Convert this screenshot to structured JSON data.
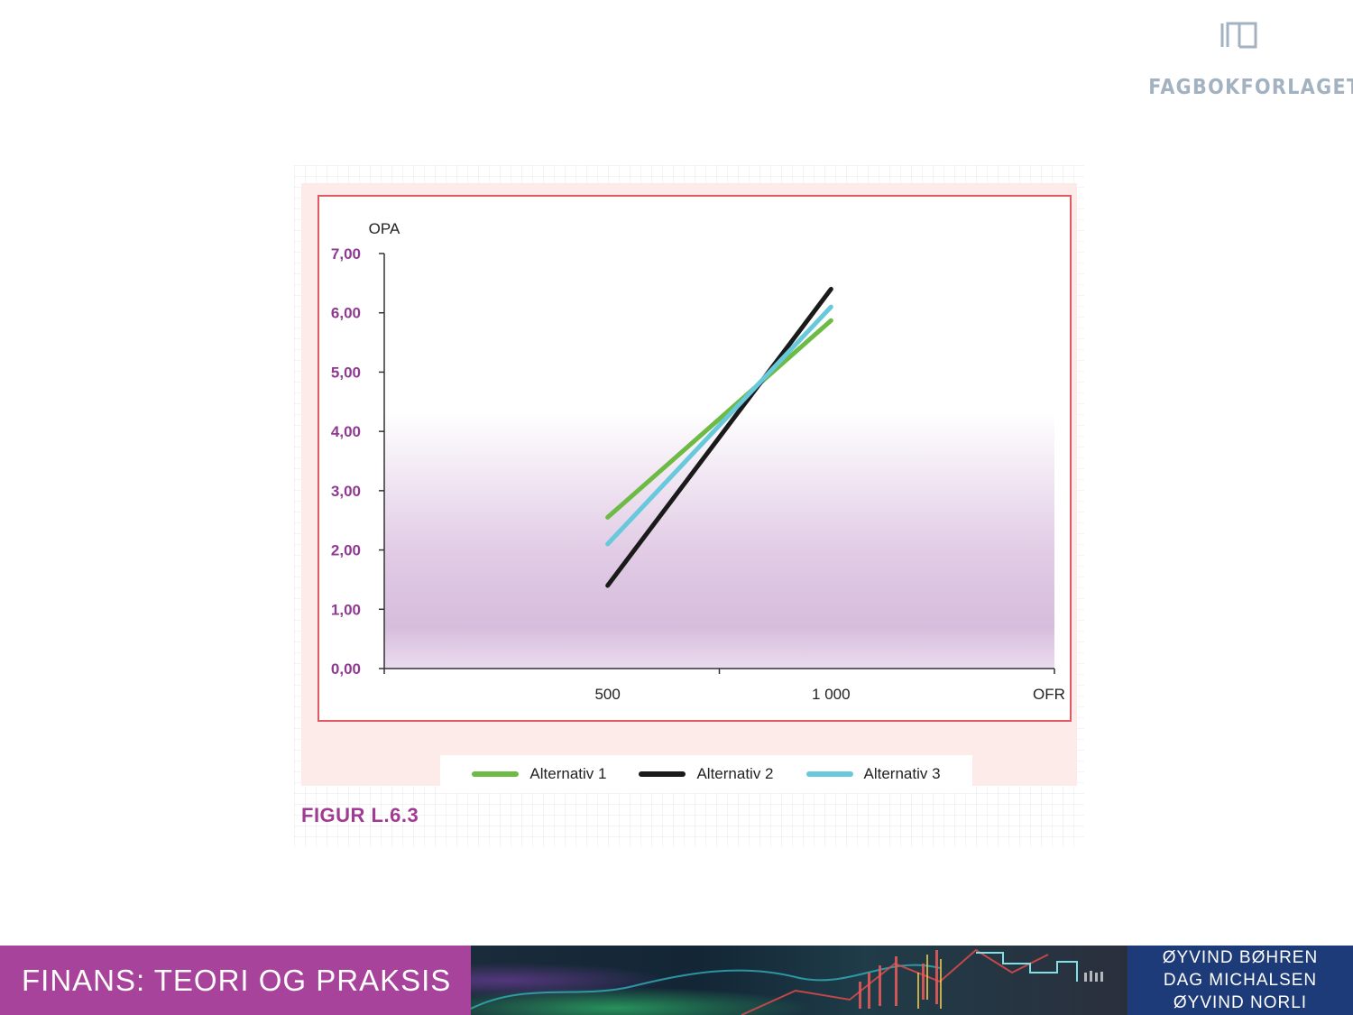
{
  "publisher": {
    "logo_text": "FAGBOKFORLAGET",
    "icon": "open-book-icon",
    "color": "#a3b2c1"
  },
  "figure": {
    "caption": "FIGUR L.6.3",
    "caption_color": "#a03a92",
    "frame_color": "#e05a64",
    "panel_color": "#fdebea"
  },
  "chart_data": {
    "type": "line",
    "title": "",
    "xlabel": "OFR",
    "ylabel": "OPA",
    "xlim": [
      0,
      1500
    ],
    "ylim": [
      0,
      7
    ],
    "x_ticks": [
      500,
      1000
    ],
    "x_tick_labels": [
      "500",
      "1 000"
    ],
    "y_ticks": [
      0,
      1,
      2,
      3,
      4,
      5,
      6,
      7
    ],
    "y_tick_labels": [
      "0,00",
      "1,00",
      "2,00",
      "3,00",
      "4,00",
      "5,00",
      "6,00",
      "7,00"
    ],
    "y_tick_label_color": "#8e3a91",
    "grid": false,
    "legend_position": "bottom",
    "series": [
      {
        "name": "Alternativ 1",
        "color": "#6dbb45",
        "x": [
          500,
          1000
        ],
        "y": [
          2.55,
          5.87
        ]
      },
      {
        "name": "Alternativ 2",
        "color": "#1a1a1a",
        "x": [
          500,
          1000
        ],
        "y": [
          1.4,
          6.4
        ]
      },
      {
        "name": "Alternativ 3",
        "color": "#68c8dc",
        "x": [
          500,
          1000
        ],
        "y": [
          2.1,
          6.1
        ]
      }
    ]
  },
  "footer": {
    "book_title": "FINANS: TEORI OG PRAKSIS",
    "title_bg": "#a8439b",
    "authors": [
      "ØYVIND BØHREN",
      "DAG MICHALSEN",
      "ØYVIND NORLI"
    ],
    "authors_bg": "#1d3b78"
  }
}
